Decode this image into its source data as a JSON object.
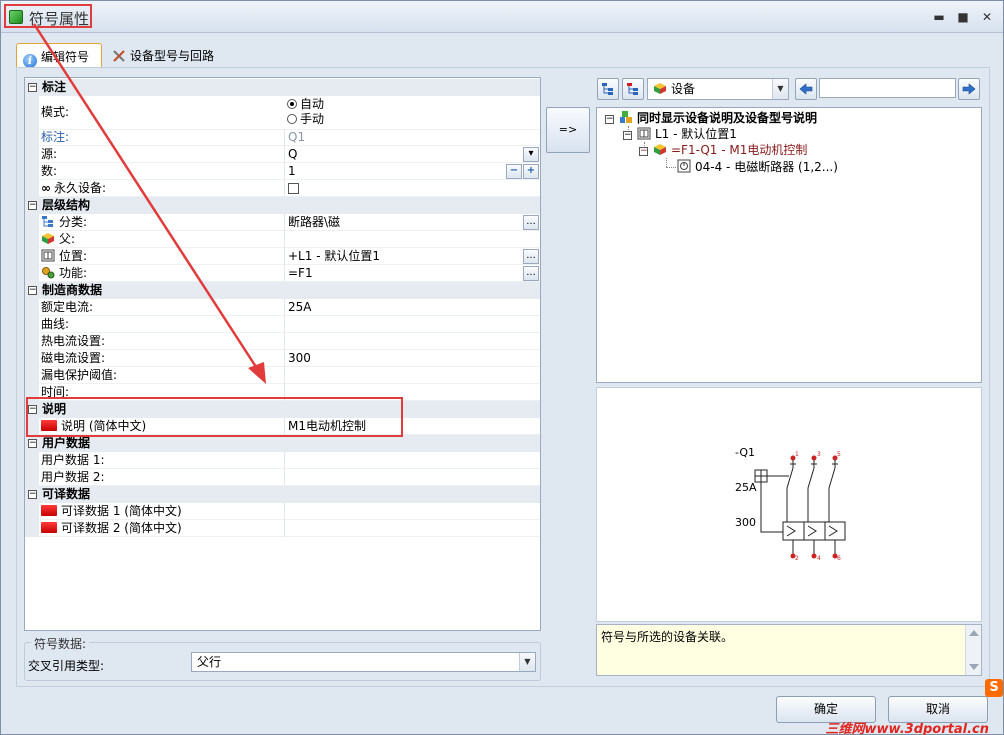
{
  "window": {
    "title": "符号属性",
    "minimize": "▬",
    "maximize": "■",
    "close": "✕"
  },
  "tabs": [
    {
      "label": "编辑符号",
      "active": true
    },
    {
      "label": "设备型号与回路",
      "active": false
    }
  ],
  "property_grid": {
    "sections": {
      "annotation": "标注",
      "hierarchy": "层级结构",
      "manufacturer": "制造商数据",
      "description": "说明",
      "user_data": "用户数据",
      "translatable": "可译数据"
    },
    "rows": {
      "mode": {
        "label": "模式:",
        "option_auto": "自动",
        "option_manual": "手动"
      },
      "tag": {
        "label": "标注:",
        "value": "Q1"
      },
      "source": {
        "label": "源:",
        "value": "Q"
      },
      "count": {
        "label": "数:",
        "value": "1",
        "minus": "−",
        "plus": "+"
      },
      "permanent": {
        "label": "永久设备:"
      },
      "category": {
        "label": "分类:",
        "value": "断路器\\磁"
      },
      "parent": {
        "label": "父:"
      },
      "location": {
        "label": "位置:",
        "value": "+L1 - 默认位置1"
      },
      "function": {
        "label": "功能:",
        "value": "=F1"
      },
      "rated_current": {
        "label": "额定电流:",
        "value": "25A"
      },
      "curve": {
        "label": "曲线:"
      },
      "thermal_current": {
        "label": "热电流设置:"
      },
      "magnetic_current": {
        "label": "磁电流设置:",
        "value": "300"
      },
      "leakage_threshold": {
        "label": "漏电保护阈值:"
      },
      "time": {
        "label": "时间:"
      },
      "description_zh": {
        "label": "说明 (简体中文)",
        "value": "M1电动机控制"
      },
      "user_data_1": {
        "label": "用户数据 1:"
      },
      "user_data_2": {
        "label": "用户数据 2:"
      },
      "trans_data_1": {
        "label": "可译数据 1 (简体中文)"
      },
      "trans_data_2": {
        "label": "可译数据 2 (简体中文)"
      }
    },
    "ellipsis": "..."
  },
  "symbol_data": {
    "legend": "符号数据:",
    "xref_label": "交叉引用类型:",
    "xref_value": "父行"
  },
  "assign_button": "=>",
  "device_panel": {
    "filter_value": "设备",
    "tree": {
      "root": "同时显示设备说明及设备型号说明",
      "location": "L1 - 默认位置1",
      "device": "=F1-Q1 - M1电动机控制",
      "component": "04-4 - 电磁断路器 (1,2...)"
    }
  },
  "preview": {
    "tag": "-Q1",
    "current": "25A",
    "setting": "300",
    "pins_top": [
      "1",
      "3",
      "5"
    ],
    "pins_bottom": [
      "2",
      "4",
      "6"
    ]
  },
  "message": "符号与所选的设备关联。",
  "buttons": {
    "ok": "确定",
    "cancel": "取消"
  },
  "watermark": {
    "text": "三维网www.3dportal.cn",
    "logo": "S"
  },
  "colors": {
    "highlight": "#e23b3b",
    "accent_tab": "#e6a23a",
    "flag_red": "#e00000"
  }
}
